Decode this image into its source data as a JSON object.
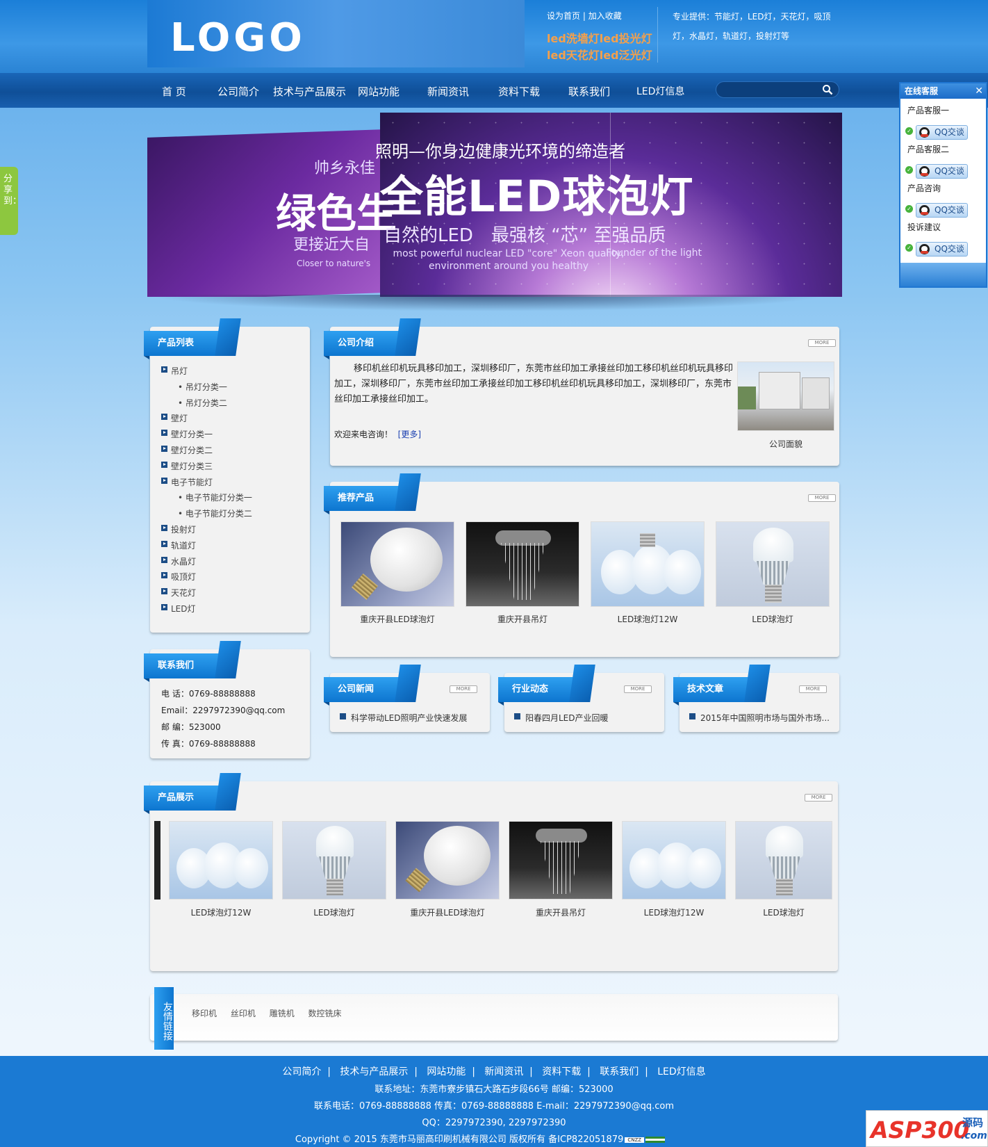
{
  "header": {
    "logo": "LOGO",
    "top_links": [
      "设为首页",
      "加入收藏"
    ],
    "hot_lines": [
      "led洗墙灯led投光灯",
      "led天花灯led泛光灯"
    ],
    "provide": "专业提供：节能灯，LED灯，天花灯，吸顶灯，水晶灯，轨道灯，投射灯等"
  },
  "nav": {
    "items": [
      "首 页",
      "公司简介",
      "技术与产品展示",
      "网站功能",
      "新闻资讯",
      "资料下载",
      "联系我们",
      "LED灯信息"
    ],
    "search_placeholder": ""
  },
  "share": "分享到：",
  "service": {
    "title": "在线客服",
    "groups": [
      "产品客服一",
      "产品客服二",
      "产品咨询",
      "投诉建议"
    ],
    "qq_label": "QQ交谈"
  },
  "banner": {
    "sub": "照明—你身边健康光环境的缔造者",
    "title": "全能LED球泡灯",
    "line": "自然的LED　最强核 “芯” 至强品质",
    "en1": "most powerful nuclear LED \"core\" Xeon quality, environment around you healthy",
    "en2": "Founder of the light",
    "left_sm": "帅乡永佳",
    "left_big": "绿色生",
    "left_sm2": "更接近大自",
    "left_en": "Closer to nature's"
  },
  "more_label": "MORE",
  "categories": {
    "title": "产品列表",
    "items": [
      {
        "label": "吊灯",
        "level": 1
      },
      {
        "label": "吊灯分类一",
        "level": 2
      },
      {
        "label": "吊灯分类二",
        "level": 2
      },
      {
        "label": "壁灯",
        "level": 1
      },
      {
        "label": "壁灯分类一",
        "level": 1
      },
      {
        "label": "壁灯分类二",
        "level": 1
      },
      {
        "label": "壁灯分类三",
        "level": 1
      },
      {
        "label": "电子节能灯",
        "level": 1
      },
      {
        "label": "电子节能灯分类一",
        "level": 2
      },
      {
        "label": "电子节能灯分类二",
        "level": 2
      },
      {
        "label": "投射灯",
        "level": 1
      },
      {
        "label": "轨道灯",
        "level": 1
      },
      {
        "label": "水晶灯",
        "level": 1
      },
      {
        "label": "吸顶灯",
        "level": 1
      },
      {
        "label": "天花灯",
        "level": 1
      },
      {
        "label": "LED灯",
        "level": 1
      }
    ]
  },
  "contact": {
    "title": "联系我们",
    "lines": [
      "电 话：0769-88888888",
      "Email：2297972390@qq.com",
      "邮 编：523000",
      "传 真：0769-88888888"
    ]
  },
  "about": {
    "title": "公司介绍",
    "text": "移印机丝印机玩具移印加工，深圳移印厂，东莞市丝印加工承接丝印加工移印机丝印机玩具移印加工，深圳移印厂，东莞市丝印加工承接丝印加工移印机丝印机玩具移印加工，深圳移印厂，东莞市丝印加工承接丝印加工。",
    "welcome": "欢迎来电咨询！",
    "more_link": "[更多]",
    "photo_caption": "公司面貌"
  },
  "recommend": {
    "title": "推荐产品",
    "items": [
      "重庆开县LED球泡灯",
      "重庆开县吊灯",
      "LED球泡灯12W",
      "LED球泡灯"
    ]
  },
  "news": [
    {
      "title": "公司新闻",
      "item": "科学带动LED照明产业快速发展"
    },
    {
      "title": "行业动态",
      "item": "阳春四月LED产业回暖"
    },
    {
      "title": "技术文章",
      "item": "2015年中国照明市场与国外市场..."
    }
  ],
  "showcase": {
    "title": "产品展示",
    "items": [
      "LED球泡灯12W",
      "LED球泡灯",
      "重庆开县LED球泡灯",
      "重庆开县吊灯",
      "LED球泡灯12W",
      "LED球泡灯"
    ]
  },
  "links": {
    "title": "友情链接",
    "items": [
      "移印机",
      "丝印机",
      "雕铣机",
      "数控铣床"
    ]
  },
  "footer": {
    "nav": [
      "公司简介",
      "技术与产品展示",
      "网站功能",
      "新闻资讯",
      "资料下载",
      "联系我们",
      "LED灯信息"
    ],
    "address": "联系地址：东莞市寮步镇石大路石步段66号 邮编：523000",
    "phone": "联系电话：0769-88888888 传真：0769-88888888 E-mail：2297972390@qq.com",
    "qq": "QQ：2297972390, 2297972390",
    "copyright": "Copyright © 2015 东莞市马丽高印刷机械有限公司 版权所有 备ICP822051879",
    "cnzz": "CNZZ",
    "asp": "ASP300",
    "asp_sub": "源码",
    "asp_com": ".com"
  }
}
